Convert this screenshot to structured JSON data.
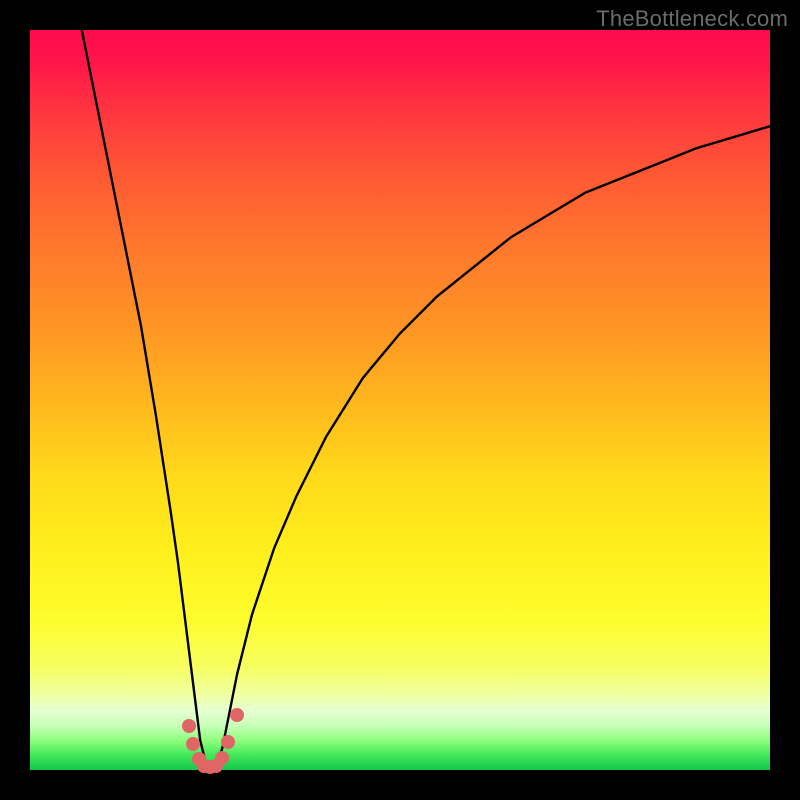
{
  "watermark": "TheBottleneck.com",
  "colors": {
    "page_bg": "#000000",
    "curve": "#000000",
    "marker": "#e06666",
    "gradient_top": "#ff0a4e",
    "gradient_bottom": "#14c64a"
  },
  "chart_data": {
    "type": "line",
    "title": "",
    "xlabel": "",
    "ylabel": "",
    "xlim": [
      0,
      100
    ],
    "ylim": [
      0,
      100
    ],
    "description": "Bottleneck curve: y-value (bottleneck %) drops steeply to ~0 at the optimum (x≈24) then rises gradually toward the right. Background gradient encodes severity (red=high, green=low). Pink markers cluster around the minimum.",
    "series": [
      {
        "name": "bottleneck-curve",
        "x": [
          7,
          9,
          11,
          13,
          15,
          17,
          19,
          20,
          21,
          22,
          23,
          24,
          25,
          26,
          27,
          28,
          30,
          33,
          36,
          40,
          45,
          50,
          55,
          60,
          65,
          70,
          75,
          80,
          85,
          90,
          95,
          100
        ],
        "y": [
          100,
          90,
          80,
          70,
          60,
          48,
          35,
          28,
          20,
          12,
          4,
          0,
          0,
          3,
          8,
          13,
          21,
          30,
          37,
          45,
          53,
          59,
          64,
          68,
          72,
          75,
          78,
          80,
          82,
          84,
          85.5,
          87
        ]
      }
    ],
    "markers": {
      "name": "optimum-cluster",
      "points": [
        {
          "x": 21.5,
          "y": 6.0
        },
        {
          "x": 22.0,
          "y": 3.5
        },
        {
          "x": 22.8,
          "y": 1.5
        },
        {
          "x": 23.5,
          "y": 0.5
        },
        {
          "x": 24.3,
          "y": 0.4
        },
        {
          "x": 25.2,
          "y": 0.6
        },
        {
          "x": 26.0,
          "y": 1.6
        },
        {
          "x": 26.8,
          "y": 3.8
        },
        {
          "x": 28.0,
          "y": 7.5
        }
      ]
    }
  }
}
